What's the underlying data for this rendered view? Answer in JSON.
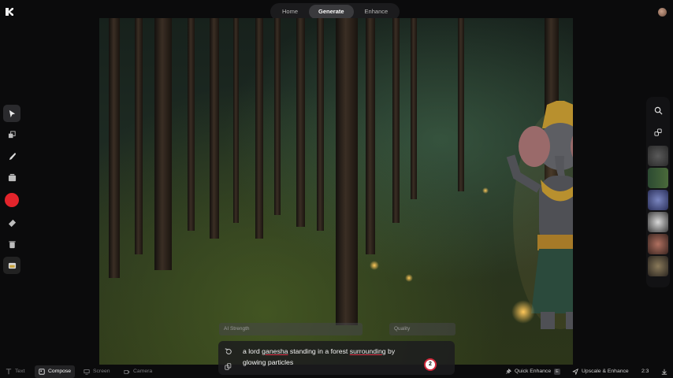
{
  "nav": {
    "tabs": [
      {
        "label": "Home"
      },
      {
        "label": "Generate"
      },
      {
        "label": "Enhance"
      }
    ],
    "active": "Generate"
  },
  "left_tools": [
    "select-icon",
    "layers-icon",
    "brush-icon",
    "stack-icon",
    "color-swatch",
    "eraser-icon",
    "trash-icon",
    "image-icon"
  ],
  "accent_color": "#e3242b",
  "right_panel": {
    "buttons": [
      "search-icon",
      "link-icon"
    ],
    "thumbnails": 6
  },
  "controls": {
    "ai_strength_placeholder": "AI Strength",
    "quality_placeholder": "Quality"
  },
  "prompt": {
    "w1": "a lord ",
    "w2": "ganesha",
    "w3": " standing in a forest ",
    "w4": "surrounding",
    "w5": " by glowing particles",
    "count": "2"
  },
  "bottom_bar": {
    "text": "Text",
    "compose": "Compose",
    "screen": "Screen",
    "camera": "Camera",
    "quick_enhance": "Quick Enhance",
    "quick_enhance_key": "E",
    "upscale": "Upscale & Enhance",
    "aspect": "2:3"
  }
}
